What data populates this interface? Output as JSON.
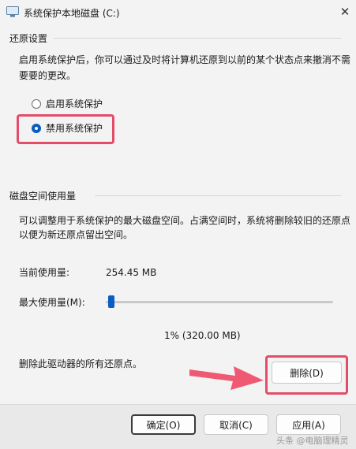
{
  "window": {
    "title": "系统保护本地磁盘 (C:)",
    "close_glyph": "✕"
  },
  "restore": {
    "heading": "还原设置",
    "description_line1": "启用系统保护后，你可以通过及时将计算机还原到以前的某个状态点来撤消不需",
    "description_line2": "要要的更改。",
    "options": [
      {
        "label": "启用系统保护",
        "selected": false
      },
      {
        "label": "禁用系统保护",
        "selected": true
      }
    ]
  },
  "disk": {
    "heading": "磁盘空间使用量",
    "description_line1": "可以调整用于系统保护的最大磁盘空间。占满空间时，系统将删除较旧的还原点",
    "description_line2": "以便为新还原点留出空间。",
    "current_usage_label": "当前使用量:",
    "current_usage_value": "254.45 MB",
    "max_usage_label": "最大使用量(M):",
    "max_usage_fraction": 0.01,
    "max_usage_value": "1% (320.00 MB)",
    "delete_text": "删除此驱动器的所有还原点。",
    "delete_button": "删除(D)"
  },
  "footer": {
    "ok": "确定(O)",
    "cancel": "取消(C)",
    "apply": "应用(A)",
    "watermark": "头条 @电脑理精灵"
  },
  "colors": {
    "accent": "#0a5dc2",
    "highlight": "#e34d6a",
    "arrow": "#ef5a72"
  }
}
